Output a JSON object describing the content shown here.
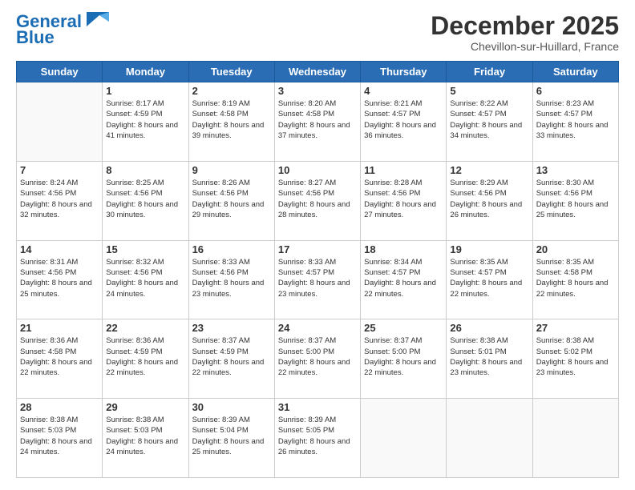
{
  "logo": {
    "line1": "General",
    "line2": "Blue"
  },
  "title": "December 2025",
  "subtitle": "Chevillon-sur-Huillard, France",
  "header": {
    "days": [
      "Sunday",
      "Monday",
      "Tuesday",
      "Wednesday",
      "Thursday",
      "Friday",
      "Saturday"
    ]
  },
  "weeks": [
    [
      {
        "day": "",
        "sunrise": "",
        "sunset": "",
        "daylight": ""
      },
      {
        "day": "1",
        "sunrise": "Sunrise: 8:17 AM",
        "sunset": "Sunset: 4:59 PM",
        "daylight": "Daylight: 8 hours and 41 minutes."
      },
      {
        "day": "2",
        "sunrise": "Sunrise: 8:19 AM",
        "sunset": "Sunset: 4:58 PM",
        "daylight": "Daylight: 8 hours and 39 minutes."
      },
      {
        "day": "3",
        "sunrise": "Sunrise: 8:20 AM",
        "sunset": "Sunset: 4:58 PM",
        "daylight": "Daylight: 8 hours and 37 minutes."
      },
      {
        "day": "4",
        "sunrise": "Sunrise: 8:21 AM",
        "sunset": "Sunset: 4:57 PM",
        "daylight": "Daylight: 8 hours and 36 minutes."
      },
      {
        "day": "5",
        "sunrise": "Sunrise: 8:22 AM",
        "sunset": "Sunset: 4:57 PM",
        "daylight": "Daylight: 8 hours and 34 minutes."
      },
      {
        "day": "6",
        "sunrise": "Sunrise: 8:23 AM",
        "sunset": "Sunset: 4:57 PM",
        "daylight": "Daylight: 8 hours and 33 minutes."
      }
    ],
    [
      {
        "day": "7",
        "sunrise": "Sunrise: 8:24 AM",
        "sunset": "Sunset: 4:56 PM",
        "daylight": "Daylight: 8 hours and 32 minutes."
      },
      {
        "day": "8",
        "sunrise": "Sunrise: 8:25 AM",
        "sunset": "Sunset: 4:56 PM",
        "daylight": "Daylight: 8 hours and 30 minutes."
      },
      {
        "day": "9",
        "sunrise": "Sunrise: 8:26 AM",
        "sunset": "Sunset: 4:56 PM",
        "daylight": "Daylight: 8 hours and 29 minutes."
      },
      {
        "day": "10",
        "sunrise": "Sunrise: 8:27 AM",
        "sunset": "Sunset: 4:56 PM",
        "daylight": "Daylight: 8 hours and 28 minutes."
      },
      {
        "day": "11",
        "sunrise": "Sunrise: 8:28 AM",
        "sunset": "Sunset: 4:56 PM",
        "daylight": "Daylight: 8 hours and 27 minutes."
      },
      {
        "day": "12",
        "sunrise": "Sunrise: 8:29 AM",
        "sunset": "Sunset: 4:56 PM",
        "daylight": "Daylight: 8 hours and 26 minutes."
      },
      {
        "day": "13",
        "sunrise": "Sunrise: 8:30 AM",
        "sunset": "Sunset: 4:56 PM",
        "daylight": "Daylight: 8 hours and 25 minutes."
      }
    ],
    [
      {
        "day": "14",
        "sunrise": "Sunrise: 8:31 AM",
        "sunset": "Sunset: 4:56 PM",
        "daylight": "Daylight: 8 hours and 25 minutes."
      },
      {
        "day": "15",
        "sunrise": "Sunrise: 8:32 AM",
        "sunset": "Sunset: 4:56 PM",
        "daylight": "Daylight: 8 hours and 24 minutes."
      },
      {
        "day": "16",
        "sunrise": "Sunrise: 8:33 AM",
        "sunset": "Sunset: 4:56 PM",
        "daylight": "Daylight: 8 hours and 23 minutes."
      },
      {
        "day": "17",
        "sunrise": "Sunrise: 8:33 AM",
        "sunset": "Sunset: 4:57 PM",
        "daylight": "Daylight: 8 hours and 23 minutes."
      },
      {
        "day": "18",
        "sunrise": "Sunrise: 8:34 AM",
        "sunset": "Sunset: 4:57 PM",
        "daylight": "Daylight: 8 hours and 22 minutes."
      },
      {
        "day": "19",
        "sunrise": "Sunrise: 8:35 AM",
        "sunset": "Sunset: 4:57 PM",
        "daylight": "Daylight: 8 hours and 22 minutes."
      },
      {
        "day": "20",
        "sunrise": "Sunrise: 8:35 AM",
        "sunset": "Sunset: 4:58 PM",
        "daylight": "Daylight: 8 hours and 22 minutes."
      }
    ],
    [
      {
        "day": "21",
        "sunrise": "Sunrise: 8:36 AM",
        "sunset": "Sunset: 4:58 PM",
        "daylight": "Daylight: 8 hours and 22 minutes."
      },
      {
        "day": "22",
        "sunrise": "Sunrise: 8:36 AM",
        "sunset": "Sunset: 4:59 PM",
        "daylight": "Daylight: 8 hours and 22 minutes."
      },
      {
        "day": "23",
        "sunrise": "Sunrise: 8:37 AM",
        "sunset": "Sunset: 4:59 PM",
        "daylight": "Daylight: 8 hours and 22 minutes."
      },
      {
        "day": "24",
        "sunrise": "Sunrise: 8:37 AM",
        "sunset": "Sunset: 5:00 PM",
        "daylight": "Daylight: 8 hours and 22 minutes."
      },
      {
        "day": "25",
        "sunrise": "Sunrise: 8:37 AM",
        "sunset": "Sunset: 5:00 PM",
        "daylight": "Daylight: 8 hours and 22 minutes."
      },
      {
        "day": "26",
        "sunrise": "Sunrise: 8:38 AM",
        "sunset": "Sunset: 5:01 PM",
        "daylight": "Daylight: 8 hours and 23 minutes."
      },
      {
        "day": "27",
        "sunrise": "Sunrise: 8:38 AM",
        "sunset": "Sunset: 5:02 PM",
        "daylight": "Daylight: 8 hours and 23 minutes."
      }
    ],
    [
      {
        "day": "28",
        "sunrise": "Sunrise: 8:38 AM",
        "sunset": "Sunset: 5:03 PM",
        "daylight": "Daylight: 8 hours and 24 minutes."
      },
      {
        "day": "29",
        "sunrise": "Sunrise: 8:38 AM",
        "sunset": "Sunset: 5:03 PM",
        "daylight": "Daylight: 8 hours and 24 minutes."
      },
      {
        "day": "30",
        "sunrise": "Sunrise: 8:39 AM",
        "sunset": "Sunset: 5:04 PM",
        "daylight": "Daylight: 8 hours and 25 minutes."
      },
      {
        "day": "31",
        "sunrise": "Sunrise: 8:39 AM",
        "sunset": "Sunset: 5:05 PM",
        "daylight": "Daylight: 8 hours and 26 minutes."
      },
      {
        "day": "",
        "sunrise": "",
        "sunset": "",
        "daylight": ""
      },
      {
        "day": "",
        "sunrise": "",
        "sunset": "",
        "daylight": ""
      },
      {
        "day": "",
        "sunrise": "",
        "sunset": "",
        "daylight": ""
      }
    ]
  ]
}
